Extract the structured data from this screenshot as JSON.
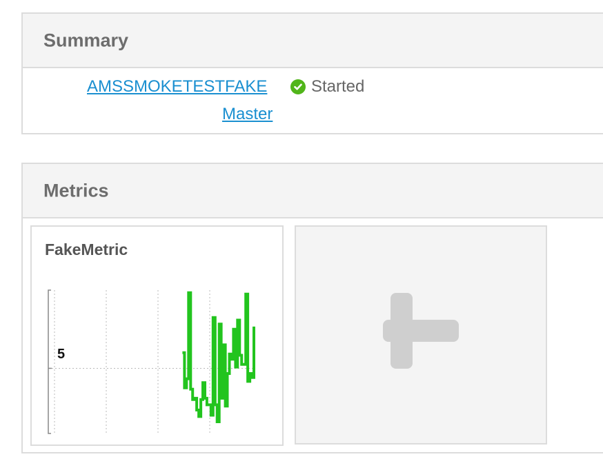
{
  "summary": {
    "title": "Summary",
    "service_link": "AMSSMOKETESTFAKE",
    "status": "Started",
    "status_color": "#51b51a",
    "role_link": "Master"
  },
  "metrics": {
    "title": "Metrics",
    "add_icon": "plus-icon",
    "cards": [
      {
        "title": "FakeMetric",
        "chart_data": {
          "type": "line",
          "title": "FakeMetric",
          "y_tick_label": "5",
          "reference_value": 5,
          "ylim": [
            0,
            11
          ],
          "grid": true,
          "line_color": "#22c41e",
          "x": [
            0,
            1,
            2,
            3,
            4,
            5,
            6,
            7,
            8,
            9,
            10,
            11,
            12,
            13,
            14,
            15,
            16,
            17,
            18,
            19,
            20,
            21,
            22,
            23,
            24,
            25,
            26,
            27,
            28,
            29,
            30,
            31,
            32,
            33,
            34,
            35,
            36,
            37,
            38,
            39,
            40,
            41,
            42,
            43,
            44,
            45,
            46,
            47,
            48,
            49,
            50,
            51,
            52,
            53,
            54,
            55,
            56,
            57,
            58,
            59,
            60,
            61,
            62,
            63,
            64,
            65,
            66,
            67,
            68,
            69,
            70,
            71,
            72,
            73,
            74,
            75,
            76,
            77,
            78,
            79,
            80,
            81,
            82,
            83,
            84,
            85,
            86,
            87,
            88,
            89,
            90,
            91,
            92,
            93,
            94,
            95,
            96,
            97,
            98,
            99
          ],
          "values": [
            null,
            null,
            null,
            null,
            null,
            null,
            null,
            null,
            null,
            null,
            null,
            null,
            null,
            null,
            null,
            null,
            null,
            null,
            null,
            null,
            null,
            null,
            null,
            null,
            null,
            null,
            null,
            null,
            null,
            null,
            null,
            null,
            null,
            null,
            null,
            null,
            null,
            null,
            null,
            null,
            null,
            null,
            null,
            null,
            null,
            null,
            null,
            null,
            null,
            null,
            null,
            null,
            null,
            null,
            null,
            null,
            null,
            null,
            null,
            null,
            null,
            null,
            null,
            null,
            6.2,
            3.5,
            4.2,
            10.8,
            3.4,
            2.6,
            2.7,
            1.8,
            1.3,
            2.6,
            3.9,
            2.7,
            2.2,
            2.2,
            1.4,
            8.9,
            2.2,
            0.9,
            8.4,
            2.7,
            6.8,
            2.1,
            4.6,
            6.1,
            5.7,
            8.0,
            5.1,
            8.7,
            6.0,
            5.3,
            5.3,
            10.7,
            4.0,
            4.6,
            4.3,
            8.2
          ]
        }
      }
    ]
  }
}
